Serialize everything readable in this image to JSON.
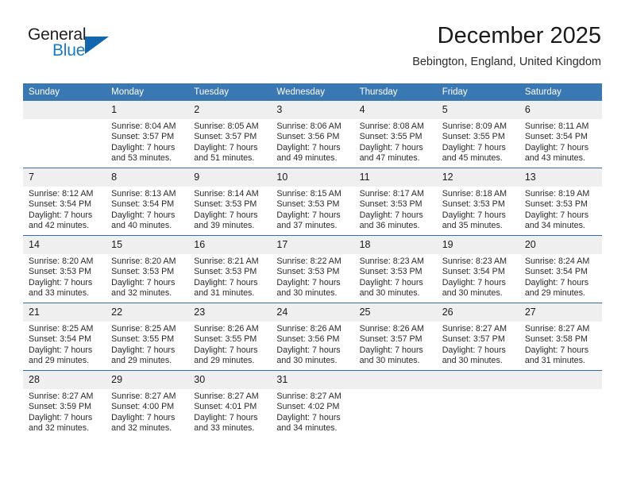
{
  "brand": {
    "name_part1": "General",
    "name_part2": "Blue",
    "triangle_color": "#1266ab",
    "blue_color": "#1b7bbf"
  },
  "header": {
    "title": "December 2025",
    "subtitle": "Bebington, England, United Kingdom"
  },
  "colors": {
    "header_blue": "#3a78b4",
    "row_divider": "#2f6fad",
    "daynum_band": "#efefef"
  },
  "calendar": {
    "weekday_headers": [
      "Sunday",
      "Monday",
      "Tuesday",
      "Wednesday",
      "Thursday",
      "Friday",
      "Saturday"
    ],
    "weeks": [
      [
        {
          "day": "",
          "sunrise": "",
          "sunset": "",
          "daylight1": "",
          "daylight2": ""
        },
        {
          "day": "1",
          "sunrise": "Sunrise: 8:04 AM",
          "sunset": "Sunset: 3:57 PM",
          "daylight1": "Daylight: 7 hours",
          "daylight2": "and 53 minutes."
        },
        {
          "day": "2",
          "sunrise": "Sunrise: 8:05 AM",
          "sunset": "Sunset: 3:57 PM",
          "daylight1": "Daylight: 7 hours",
          "daylight2": "and 51 minutes."
        },
        {
          "day": "3",
          "sunrise": "Sunrise: 8:06 AM",
          "sunset": "Sunset: 3:56 PM",
          "daylight1": "Daylight: 7 hours",
          "daylight2": "and 49 minutes."
        },
        {
          "day": "4",
          "sunrise": "Sunrise: 8:08 AM",
          "sunset": "Sunset: 3:55 PM",
          "daylight1": "Daylight: 7 hours",
          "daylight2": "and 47 minutes."
        },
        {
          "day": "5",
          "sunrise": "Sunrise: 8:09 AM",
          "sunset": "Sunset: 3:55 PM",
          "daylight1": "Daylight: 7 hours",
          "daylight2": "and 45 minutes."
        },
        {
          "day": "6",
          "sunrise": "Sunrise: 8:11 AM",
          "sunset": "Sunset: 3:54 PM",
          "daylight1": "Daylight: 7 hours",
          "daylight2": "and 43 minutes."
        }
      ],
      [
        {
          "day": "7",
          "sunrise": "Sunrise: 8:12 AM",
          "sunset": "Sunset: 3:54 PM",
          "daylight1": "Daylight: 7 hours",
          "daylight2": "and 42 minutes."
        },
        {
          "day": "8",
          "sunrise": "Sunrise: 8:13 AM",
          "sunset": "Sunset: 3:54 PM",
          "daylight1": "Daylight: 7 hours",
          "daylight2": "and 40 minutes."
        },
        {
          "day": "9",
          "sunrise": "Sunrise: 8:14 AM",
          "sunset": "Sunset: 3:53 PM",
          "daylight1": "Daylight: 7 hours",
          "daylight2": "and 39 minutes."
        },
        {
          "day": "10",
          "sunrise": "Sunrise: 8:15 AM",
          "sunset": "Sunset: 3:53 PM",
          "daylight1": "Daylight: 7 hours",
          "daylight2": "and 37 minutes."
        },
        {
          "day": "11",
          "sunrise": "Sunrise: 8:17 AM",
          "sunset": "Sunset: 3:53 PM",
          "daylight1": "Daylight: 7 hours",
          "daylight2": "and 36 minutes."
        },
        {
          "day": "12",
          "sunrise": "Sunrise: 8:18 AM",
          "sunset": "Sunset: 3:53 PM",
          "daylight1": "Daylight: 7 hours",
          "daylight2": "and 35 minutes."
        },
        {
          "day": "13",
          "sunrise": "Sunrise: 8:19 AM",
          "sunset": "Sunset: 3:53 PM",
          "daylight1": "Daylight: 7 hours",
          "daylight2": "and 34 minutes."
        }
      ],
      [
        {
          "day": "14",
          "sunrise": "Sunrise: 8:20 AM",
          "sunset": "Sunset: 3:53 PM",
          "daylight1": "Daylight: 7 hours",
          "daylight2": "and 33 minutes."
        },
        {
          "day": "15",
          "sunrise": "Sunrise: 8:20 AM",
          "sunset": "Sunset: 3:53 PM",
          "daylight1": "Daylight: 7 hours",
          "daylight2": "and 32 minutes."
        },
        {
          "day": "16",
          "sunrise": "Sunrise: 8:21 AM",
          "sunset": "Sunset: 3:53 PM",
          "daylight1": "Daylight: 7 hours",
          "daylight2": "and 31 minutes."
        },
        {
          "day": "17",
          "sunrise": "Sunrise: 8:22 AM",
          "sunset": "Sunset: 3:53 PM",
          "daylight1": "Daylight: 7 hours",
          "daylight2": "and 30 minutes."
        },
        {
          "day": "18",
          "sunrise": "Sunrise: 8:23 AM",
          "sunset": "Sunset: 3:53 PM",
          "daylight1": "Daylight: 7 hours",
          "daylight2": "and 30 minutes."
        },
        {
          "day": "19",
          "sunrise": "Sunrise: 8:23 AM",
          "sunset": "Sunset: 3:54 PM",
          "daylight1": "Daylight: 7 hours",
          "daylight2": "and 30 minutes."
        },
        {
          "day": "20",
          "sunrise": "Sunrise: 8:24 AM",
          "sunset": "Sunset: 3:54 PM",
          "daylight1": "Daylight: 7 hours",
          "daylight2": "and 29 minutes."
        }
      ],
      [
        {
          "day": "21",
          "sunrise": "Sunrise: 8:25 AM",
          "sunset": "Sunset: 3:54 PM",
          "daylight1": "Daylight: 7 hours",
          "daylight2": "and 29 minutes."
        },
        {
          "day": "22",
          "sunrise": "Sunrise: 8:25 AM",
          "sunset": "Sunset: 3:55 PM",
          "daylight1": "Daylight: 7 hours",
          "daylight2": "and 29 minutes."
        },
        {
          "day": "23",
          "sunrise": "Sunrise: 8:26 AM",
          "sunset": "Sunset: 3:55 PM",
          "daylight1": "Daylight: 7 hours",
          "daylight2": "and 29 minutes."
        },
        {
          "day": "24",
          "sunrise": "Sunrise: 8:26 AM",
          "sunset": "Sunset: 3:56 PM",
          "daylight1": "Daylight: 7 hours",
          "daylight2": "and 30 minutes."
        },
        {
          "day": "25",
          "sunrise": "Sunrise: 8:26 AM",
          "sunset": "Sunset: 3:57 PM",
          "daylight1": "Daylight: 7 hours",
          "daylight2": "and 30 minutes."
        },
        {
          "day": "26",
          "sunrise": "Sunrise: 8:27 AM",
          "sunset": "Sunset: 3:57 PM",
          "daylight1": "Daylight: 7 hours",
          "daylight2": "and 30 minutes."
        },
        {
          "day": "27",
          "sunrise": "Sunrise: 8:27 AM",
          "sunset": "Sunset: 3:58 PM",
          "daylight1": "Daylight: 7 hours",
          "daylight2": "and 31 minutes."
        }
      ],
      [
        {
          "day": "28",
          "sunrise": "Sunrise: 8:27 AM",
          "sunset": "Sunset: 3:59 PM",
          "daylight1": "Daylight: 7 hours",
          "daylight2": "and 32 minutes."
        },
        {
          "day": "29",
          "sunrise": "Sunrise: 8:27 AM",
          "sunset": "Sunset: 4:00 PM",
          "daylight1": "Daylight: 7 hours",
          "daylight2": "and 32 minutes."
        },
        {
          "day": "30",
          "sunrise": "Sunrise: 8:27 AM",
          "sunset": "Sunset: 4:01 PM",
          "daylight1": "Daylight: 7 hours",
          "daylight2": "and 33 minutes."
        },
        {
          "day": "31",
          "sunrise": "Sunrise: 8:27 AM",
          "sunset": "Sunset: 4:02 PM",
          "daylight1": "Daylight: 7 hours",
          "daylight2": "and 34 minutes."
        },
        {
          "day": "",
          "sunrise": "",
          "sunset": "",
          "daylight1": "",
          "daylight2": ""
        },
        {
          "day": "",
          "sunrise": "",
          "sunset": "",
          "daylight1": "",
          "daylight2": ""
        },
        {
          "day": "",
          "sunrise": "",
          "sunset": "",
          "daylight1": "",
          "daylight2": ""
        }
      ]
    ]
  }
}
